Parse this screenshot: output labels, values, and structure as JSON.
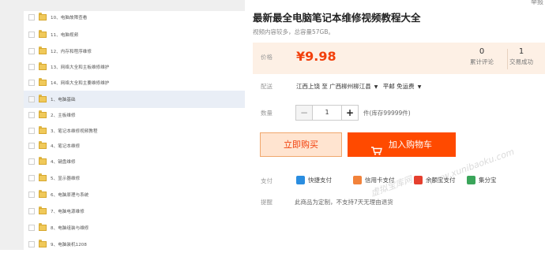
{
  "gallery": {
    "items": [
      {
        "label": "10、电脑故障查看"
      },
      {
        "label": "11、电脑视频"
      },
      {
        "label": "12、内存和程序维修"
      },
      {
        "label": "13、网络大全和主板维修维护"
      },
      {
        "label": "14、网络大全和主要维修维护"
      },
      {
        "label": "1、电脑基础"
      },
      {
        "label": "2、主板维修"
      },
      {
        "label": "3、笔记本维修视频教程"
      },
      {
        "label": "4、笔记本维修"
      },
      {
        "label": "4、键盘维修"
      },
      {
        "label": "5、显示器维修"
      },
      {
        "label": "6、电脑原理与系统"
      },
      {
        "label": "7、电脑电源维修"
      },
      {
        "label": "8、电脑组装与维修"
      },
      {
        "label": "9、电脑装机1208"
      }
    ]
  },
  "product": {
    "corner": "举报",
    "title": "最新最全电脑笔记本维修视频教程大全",
    "subtitle": "视频内容较多，总容量57GB。",
    "price_label": "价格",
    "price": "¥9.98",
    "reviews_count": "0",
    "reviews_label": "累计评论",
    "deals_count": "1",
    "deals_label": "交易成功"
  },
  "shipping": {
    "label": "配送",
    "from": "江西上饶 至",
    "to": "广西柳州柳江县",
    "method": "平邮 免运费"
  },
  "quantity": {
    "label": "数量",
    "minus": "−",
    "value": "1",
    "plus": "+",
    "stock": "件(库存99999件)"
  },
  "actions": {
    "buy_now": "立即购买",
    "add_to_cart": "加入购物车"
  },
  "payment": {
    "label": "支付",
    "methods": [
      {
        "name": "快捷支付",
        "icon": "quick-pay-icon",
        "color": "#2a8de0"
      },
      {
        "name": "信用卡支付",
        "icon": "credit-card-icon",
        "color": "#f2823a"
      },
      {
        "name": "余额宝支付",
        "icon": "yuebao-icon",
        "color": "#e53f2e"
      },
      {
        "name": "集分宝",
        "icon": "jifenbao-icon",
        "color": "#3aa55a"
      }
    ]
  },
  "tip": {
    "label": "提醒",
    "text": "此商品为定制，不支持7天无理由退货"
  },
  "watermarks": {
    "site": "www.xunibaoku.com",
    "brand": "虚拟宝库网"
  },
  "colors": {
    "accent": "#ff4a00",
    "price": "#f2400c",
    "price_bg": "#fdf0e5"
  }
}
